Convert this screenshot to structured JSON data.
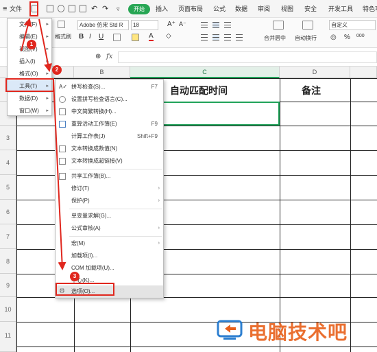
{
  "menubar": {
    "menu_icon": "≡",
    "file_label": "文件",
    "items": [
      "开始",
      "插入",
      "页面布局",
      "公式",
      "数据",
      "审阅",
      "视图",
      "安全",
      "开发工具",
      "特色功"
    ]
  },
  "ribbon": {
    "format_painter": "格式刷",
    "font_name": "Adobe 仿宋 Std R",
    "font_size": "18",
    "merge_label": "合并居中",
    "wrap_label": "自动换行",
    "number_format": "自定义",
    "percent": "%",
    "decimals": "000"
  },
  "formula_bar": {
    "fx": "fx",
    "value": ""
  },
  "columns": [
    "B",
    "C",
    "D"
  ],
  "rows": [
    "3",
    "4",
    "5",
    "6",
    "7",
    "8",
    "9",
    "10",
    "11"
  ],
  "cells": {
    "c1": "自动匹配时间",
    "d1": "备注"
  },
  "file_menu": {
    "items": [
      {
        "label": "文件(F)",
        "has_arrow": true
      },
      {
        "label": "编辑(E)",
        "has_arrow": true
      },
      {
        "label": "视图(V)",
        "has_arrow": true
      },
      {
        "label": "插入(I)",
        "has_arrow": true
      },
      {
        "label": "格式(O)",
        "has_arrow": true
      },
      {
        "label": "工具(T)",
        "has_arrow": true
      },
      {
        "label": "数据(D)",
        "has_arrow": true
      },
      {
        "label": "窗口(W)",
        "has_arrow": true
      }
    ]
  },
  "tools_menu": {
    "items": [
      {
        "label": "拼写检查(S)...",
        "shortcut": "F7",
        "icon": "spellcheck-icon"
      },
      {
        "label": "设置拼写检查语言(C)...",
        "shortcut": "",
        "icon": "language-icon"
      },
      {
        "label": "中文简繁转换(H)...",
        "shortcut": "",
        "icon": "convert-icon"
      },
      {
        "label": "重算活动工作簿(E)",
        "shortcut": "F9",
        "icon": "recalc-icon"
      },
      {
        "label": "计算工作表(J)",
        "shortcut": "Shift+F9",
        "icon": ""
      },
      {
        "label": "文本转换成数值(N)",
        "shortcut": "",
        "icon": "text-number-icon"
      },
      {
        "label": "文本转换成超链接(V)",
        "shortcut": "",
        "icon": "hyperlink-icon"
      },
      {
        "label": "共享工作簿(B)...",
        "shortcut": "",
        "icon": "share-icon"
      },
      {
        "label": "修订(T)",
        "shortcut": "",
        "arrow": true,
        "icon": ""
      },
      {
        "label": "保护(P)",
        "shortcut": "",
        "arrow": true,
        "icon": ""
      },
      {
        "label": "单变量求解(G)...",
        "shortcut": "",
        "icon": ""
      },
      {
        "label": "公式审核(A)",
        "shortcut": "",
        "arrow": true,
        "icon": ""
      },
      {
        "label": "宏(M)",
        "shortcut": "",
        "arrow": true,
        "icon": ""
      },
      {
        "label": "加载项(I)...",
        "shortcut": "",
        "icon": ""
      },
      {
        "label": "COM 加载项(U)...",
        "shortcut": "",
        "icon": ""
      },
      {
        "label": "中心(K)...",
        "shortcut": "",
        "icon": ""
      },
      {
        "label": "选项(O)...",
        "shortcut": "",
        "icon": "gear-icon"
      }
    ]
  },
  "annotations": {
    "step1": "1",
    "step2": "2",
    "step3": "3",
    "color": "#e0271e"
  },
  "watermark": {
    "text": "电脑技术吧",
    "color": "#e8601a"
  }
}
